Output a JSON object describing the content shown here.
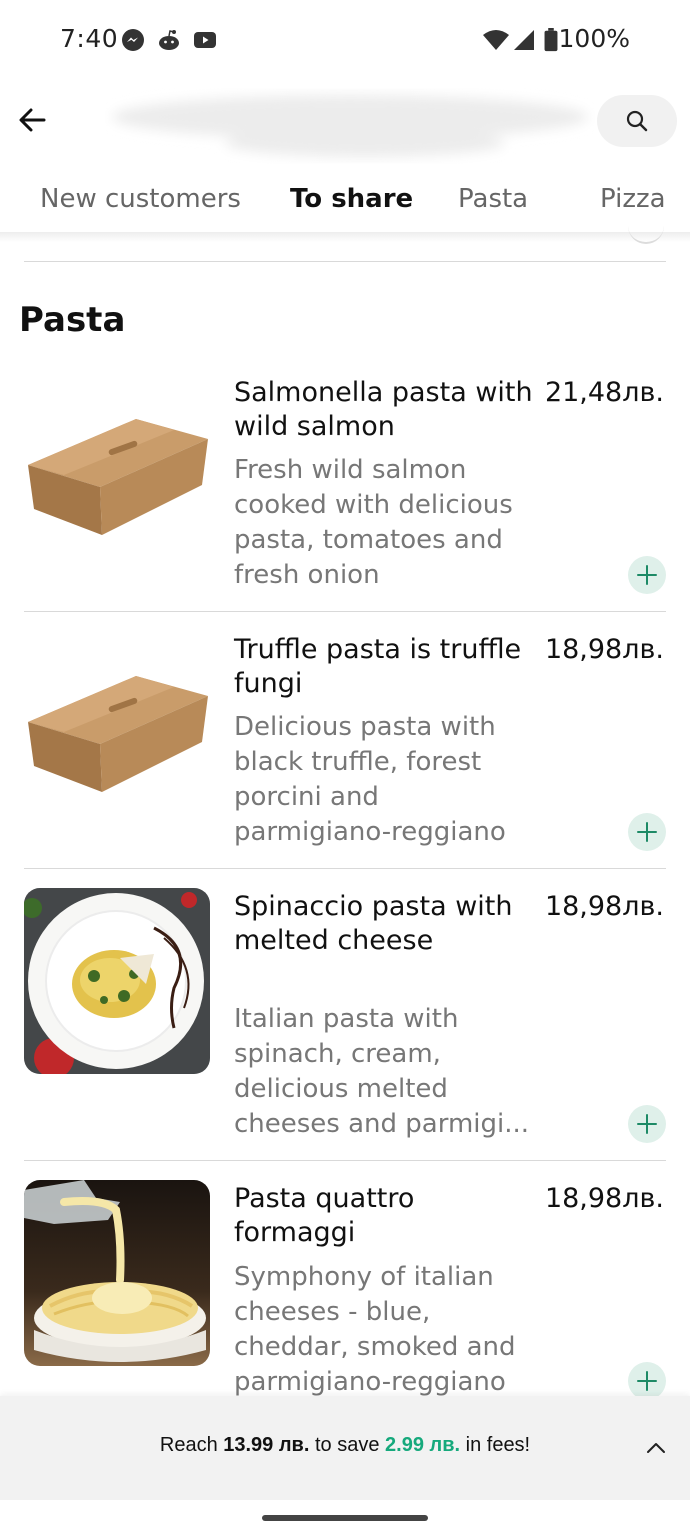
{
  "status_bar": {
    "time": "7:40",
    "battery": "100%",
    "icons": [
      "messenger-icon",
      "reddit-icon",
      "youtube-icon",
      "wifi-icon",
      "signal-icon",
      "battery-icon"
    ]
  },
  "header": {
    "back_icon": "arrow-left-icon",
    "search_icon": "search-icon"
  },
  "tabs": [
    {
      "label": "New customers",
      "active": false
    },
    {
      "label": "To share",
      "active": true
    },
    {
      "label": "Pasta",
      "active": false
    },
    {
      "label": "Pizza",
      "active": false
    }
  ],
  "section": {
    "title": "Pasta"
  },
  "items": [
    {
      "name": "Salmonella pasta with wild salmon",
      "price": "21,48лв.",
      "description": "Fresh wild salmon cooked with delicious pasta, tomatoes and fresh onion",
      "image": "takeaway-box-image"
    },
    {
      "name": "Truffle pasta is truffle fungi",
      "price": "18,98лв.",
      "description": "Delicious pasta with black truffle, forest porcini and parmigiano-reggiano",
      "image": "takeaway-box-image"
    },
    {
      "name": "Spinaccio pasta with melted cheese",
      "price": "18,98лв.",
      "description_lines": [
        "Italian pasta with",
        "spinach, cream,",
        "delicious melted",
        "cheeses and parmigi..."
      ],
      "image": "spinach-pasta-plate-image"
    },
    {
      "name": "Pasta quattro formaggi",
      "price": "18,98лв.",
      "description": "Symphony of italian cheeses - blue, cheddar, smoked and parmigiano-reggiano",
      "image": "cheese-sauce-pasta-image"
    }
  ],
  "banner": {
    "prefix": "Reach ",
    "amount": "13.99 лв.",
    "middle": " to save ",
    "savings": "2.99 лв.",
    "suffix": " in fees!"
  },
  "colors": {
    "accent_yellow": "#f4c34a",
    "accent_green": "#16a97c",
    "add_button_bg": "#dff0ea"
  }
}
